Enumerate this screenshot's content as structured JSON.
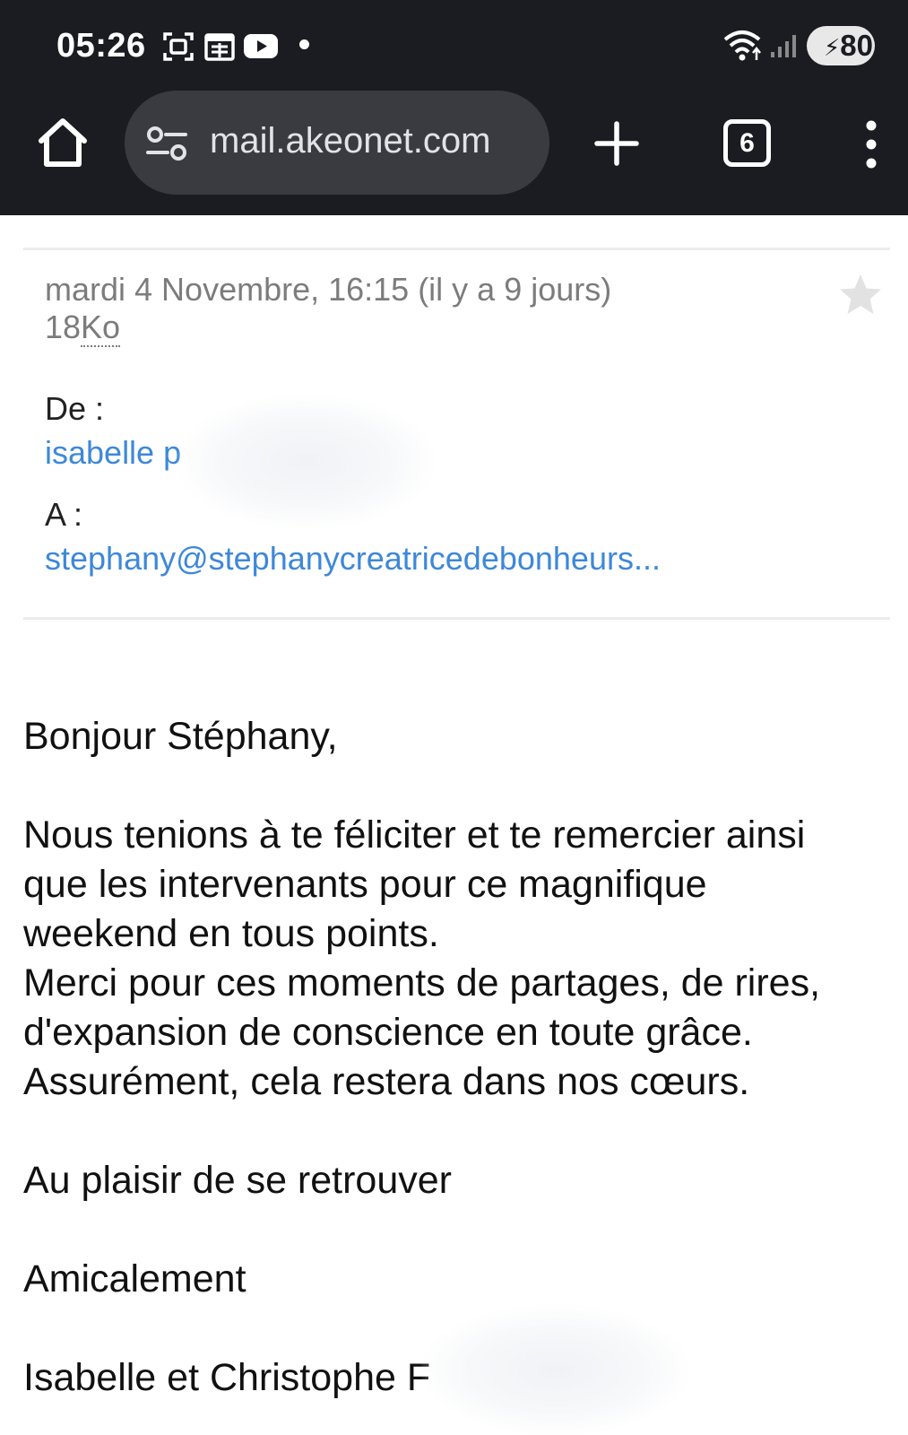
{
  "status_bar": {
    "time": "05:26",
    "battery": "80",
    "icons": [
      "screenshot-icon",
      "calendar-icon",
      "youtube-icon",
      "notification-dot",
      "wifi-icon",
      "signal-icon",
      "battery-icon"
    ]
  },
  "browser": {
    "url": "mail.akeonet.com",
    "tab_count": "6",
    "icons": [
      "home-icon",
      "site-settings-icon",
      "plus-icon",
      "tabs-icon",
      "more-vert-icon"
    ]
  },
  "mail": {
    "date": "mardi 4 Novembre, 16:15 (il y a 9 jours)",
    "size_number": "18",
    "size_unit": "Ko",
    "from_label": "De :",
    "from_value": "isabelle p",
    "to_label": "A :",
    "to_value": "stephany@stephanycreatricedebonheurs...",
    "body": {
      "greeting": "Bonjour Stéphany,",
      "p1_l1": "Nous tenions à te féliciter et te remercier ainsi",
      "p1_l2": "que les intervenants pour ce magnifique",
      "p1_l3": "weekend en tous points.",
      "p1_l4": "Merci pour ces moments de partages, de rires,",
      "p1_l5": "d'expansion de conscience en toute grâce.",
      "p1_l6": "Assurément, cela restera dans nos cœurs.",
      "closing1": "Au plaisir de se retrouver",
      "closing2": "Amicalement",
      "signature": "Isabelle et Christophe F"
    }
  }
}
